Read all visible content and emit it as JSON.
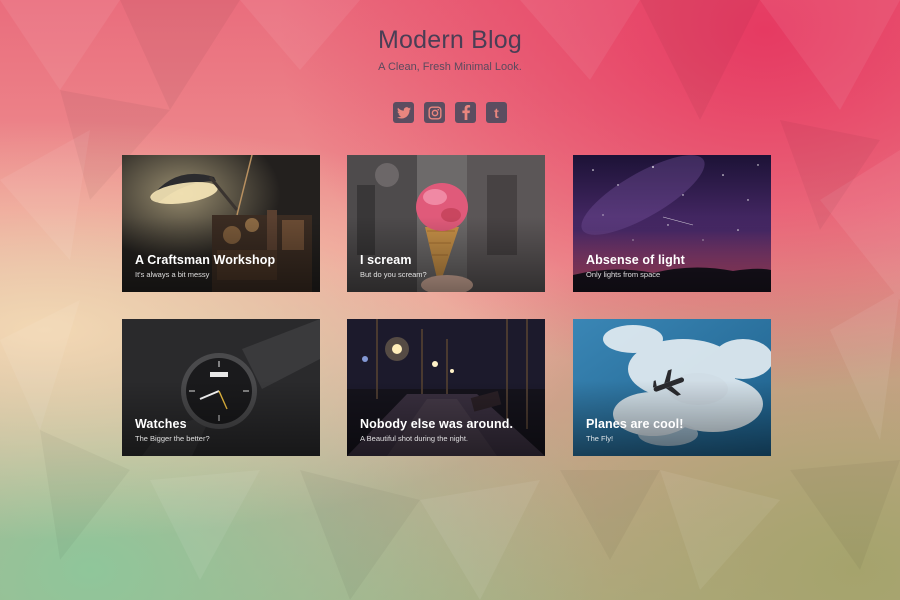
{
  "site": {
    "title": "Modern Blog",
    "tagline": "A Clean, Fresh Minimal Look."
  },
  "socials": [
    {
      "name": "twitter",
      "icon": "twitter-icon"
    },
    {
      "name": "instagram",
      "icon": "instagram-icon"
    },
    {
      "name": "facebook",
      "icon": "facebook-icon"
    },
    {
      "name": "tumblr",
      "icon": "tumblr-icon",
      "glyph": "t"
    }
  ],
  "posts": [
    {
      "title": "A Craftsman Workshop",
      "subtitle": "It's always a bit messy",
      "image": "workshop-lamp-photo"
    },
    {
      "title": "I scream",
      "subtitle": "But do you scream?",
      "image": "ice-cream-cone-photo"
    },
    {
      "title": "Absense of light",
      "subtitle": "Only lights from space",
      "image": "starry-night-sky-photo"
    },
    {
      "title": "Watches",
      "subtitle": "The Bigger the better?",
      "image": "wristwatch-photo"
    },
    {
      "title": "Nobody else was around.",
      "subtitle": "A Beautiful shot during the night.",
      "image": "night-street-bench-photo"
    },
    {
      "title": "Planes are cool!",
      "subtitle": "The Fly!",
      "image": "airplane-clouds-photo"
    }
  ],
  "colors": {
    "text_dark": "#4a3e55",
    "icon_bg": "#5c4d60",
    "bg_top": "#e63a62",
    "bg_bottom_left": "#8fc69a"
  }
}
